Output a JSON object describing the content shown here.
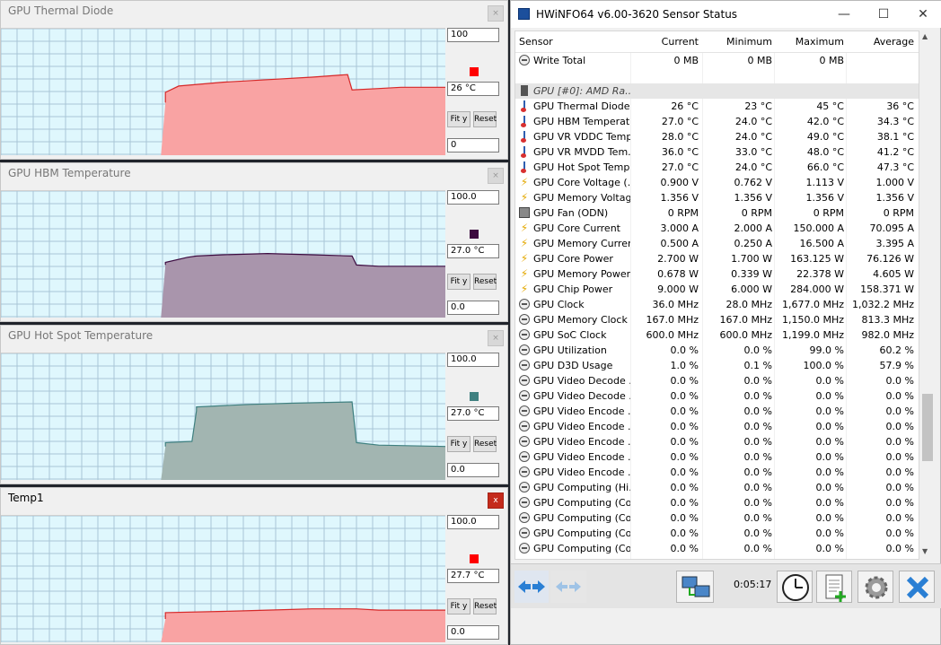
{
  "graphs": [
    {
      "title": "GPU Thermal Diode",
      "top": "100",
      "current": "26 °C",
      "bottom": "0",
      "color": "#ff0000",
      "fill": "#f9a3a3",
      "stroke": "#d62828",
      "active": false,
      "close": "×",
      "trace": [
        [
          0,
          40
        ],
        [
          10,
          40
        ],
        [
          10,
          42
        ],
        [
          37,
          42
        ],
        [
          37,
          50
        ],
        [
          40,
          55
        ],
        [
          50,
          58
        ],
        [
          60,
          60
        ],
        [
          70,
          62
        ],
        [
          78,
          64
        ],
        [
          79,
          52
        ],
        [
          85,
          53
        ],
        [
          90,
          54
        ],
        [
          95,
          54
        ],
        [
          100,
          54
        ]
      ],
      "ymax": 100
    },
    {
      "title": "GPU HBM Temperature",
      "top": "100.0",
      "current": "27.0 °C",
      "bottom": "0.0",
      "color": "#3d0b40",
      "fill": "#a995ac",
      "stroke": "#3d0b40",
      "active": false,
      "close": "×",
      "trace": [
        [
          0,
          40
        ],
        [
          10,
          40
        ],
        [
          10,
          42
        ],
        [
          37,
          42
        ],
        [
          37,
          44
        ],
        [
          42,
          48
        ],
        [
          44,
          49
        ],
        [
          50,
          50
        ],
        [
          60,
          51
        ],
        [
          70,
          50
        ],
        [
          79,
          49
        ],
        [
          80,
          42
        ],
        [
          85,
          41
        ],
        [
          100,
          41
        ]
      ],
      "ymax": 100
    },
    {
      "title": "GPU Hot Spot Temperature",
      "top": "100.0",
      "current": "27.0 °C",
      "bottom": "0.0",
      "color": "#3f8080",
      "fill": "#a2b5b1",
      "stroke": "#3f8080",
      "active": false,
      "close": "×",
      "trace": [
        [
          0,
          25
        ],
        [
          10,
          25
        ],
        [
          10,
          27
        ],
        [
          37,
          27
        ],
        [
          37,
          30
        ],
        [
          43,
          31
        ],
        [
          44,
          55
        ],
        [
          44,
          58
        ],
        [
          56,
          60
        ],
        [
          66,
          61
        ],
        [
          79,
          62
        ],
        [
          80,
          30
        ],
        [
          85,
          28
        ],
        [
          100,
          27
        ]
      ],
      "ymax": 100
    },
    {
      "title": "Temp1",
      "top": "100.0",
      "current": "27.7 °C",
      "bottom": "0.0",
      "color": "#ff0000",
      "fill": "#f9a3a3",
      "stroke": "#d62828",
      "active": true,
      "close": "x",
      "trace": [
        [
          0,
          18
        ],
        [
          10,
          18
        ],
        [
          10,
          19
        ],
        [
          37,
          19
        ],
        [
          37,
          24
        ],
        [
          50,
          25
        ],
        [
          60,
          26
        ],
        [
          70,
          27
        ],
        [
          80,
          27
        ],
        [
          85,
          26
        ],
        [
          100,
          26
        ]
      ],
      "ymax": 100
    }
  ],
  "fit_label": "Fit y",
  "reset_label": "Reset",
  "hwinfo": {
    "title": "HWiNFO64 v6.00-3620 Sensor Status",
    "columns": [
      "Sensor",
      "Current",
      "Minimum",
      "Maximum",
      "Average"
    ],
    "rows": [
      {
        "icon": "clock",
        "name": "Write Total",
        "cur": "0 MB",
        "min": "0 MB",
        "max": "0 MB",
        "avg": ""
      },
      {
        "icon": "none",
        "name": "",
        "cur": "",
        "min": "",
        "max": "",
        "avg": ""
      },
      {
        "icon": "gpu",
        "name": "GPU [#0]: AMD Ra...",
        "cur": "",
        "min": "",
        "max": "",
        "avg": "",
        "group": true
      },
      {
        "icon": "temp",
        "name": "GPU Thermal Diode",
        "cur": "26 °C",
        "min": "23 °C",
        "max": "45 °C",
        "avg": "36 °C"
      },
      {
        "icon": "temp",
        "name": "GPU HBM Temperat...",
        "cur": "27.0 °C",
        "min": "24.0 °C",
        "max": "42.0 °C",
        "avg": "34.3 °C"
      },
      {
        "icon": "temp",
        "name": "GPU VR VDDC Temp...",
        "cur": "28.0 °C",
        "min": "24.0 °C",
        "max": "49.0 °C",
        "avg": "38.1 °C"
      },
      {
        "icon": "temp",
        "name": "GPU VR MVDD Tem...",
        "cur": "36.0 °C",
        "min": "33.0 °C",
        "max": "48.0 °C",
        "avg": "41.2 °C"
      },
      {
        "icon": "temp",
        "name": "GPU Hot Spot Temp...",
        "cur": "27.0 °C",
        "min": "24.0 °C",
        "max": "66.0 °C",
        "avg": "47.3 °C"
      },
      {
        "icon": "volt",
        "name": "GPU Core Voltage (...",
        "cur": "0.900 V",
        "min": "0.762 V",
        "max": "1.113 V",
        "avg": "1.000 V"
      },
      {
        "icon": "volt",
        "name": "GPU Memory Voltag...",
        "cur": "1.356 V",
        "min": "1.356 V",
        "max": "1.356 V",
        "avg": "1.356 V"
      },
      {
        "icon": "fan",
        "name": "GPU Fan (ODN)",
        "cur": "0 RPM",
        "min": "0 RPM",
        "max": "0 RPM",
        "avg": "0 RPM"
      },
      {
        "icon": "volt",
        "name": "GPU Core Current",
        "cur": "3.000 A",
        "min": "2.000 A",
        "max": "150.000 A",
        "avg": "70.095 A"
      },
      {
        "icon": "volt",
        "name": "GPU Memory Current",
        "cur": "0.500 A",
        "min": "0.250 A",
        "max": "16.500 A",
        "avg": "3.395 A"
      },
      {
        "icon": "volt",
        "name": "GPU Core Power",
        "cur": "2.700 W",
        "min": "1.700 W",
        "max": "163.125 W",
        "avg": "76.126 W"
      },
      {
        "icon": "volt",
        "name": "GPU Memory Power",
        "cur": "0.678 W",
        "min": "0.339 W",
        "max": "22.378 W",
        "avg": "4.605 W"
      },
      {
        "icon": "volt",
        "name": "GPU Chip Power",
        "cur": "9.000 W",
        "min": "6.000 W",
        "max": "284.000 W",
        "avg": "158.371 W"
      },
      {
        "icon": "clock",
        "name": "GPU Clock",
        "cur": "36.0 MHz",
        "min": "28.0 MHz",
        "max": "1,677.0 MHz",
        "avg": "1,032.2 MHz"
      },
      {
        "icon": "clock",
        "name": "GPU Memory Clock",
        "cur": "167.0 MHz",
        "min": "167.0 MHz",
        "max": "1,150.0 MHz",
        "avg": "813.3 MHz"
      },
      {
        "icon": "clock",
        "name": "GPU SoC Clock",
        "cur": "600.0 MHz",
        "min": "600.0 MHz",
        "max": "1,199.0 MHz",
        "avg": "982.0 MHz"
      },
      {
        "icon": "clock",
        "name": "GPU Utilization",
        "cur": "0.0 %",
        "min": "0.0 %",
        "max": "99.0 %",
        "avg": "60.2 %"
      },
      {
        "icon": "clock",
        "name": "GPU D3D Usage",
        "cur": "1.0 %",
        "min": "0.1 %",
        "max": "100.0 %",
        "avg": "57.9 %"
      },
      {
        "icon": "clock",
        "name": "GPU Video Decode ...",
        "cur": "0.0 %",
        "min": "0.0 %",
        "max": "0.0 %",
        "avg": "0.0 %"
      },
      {
        "icon": "clock",
        "name": "GPU Video Decode ...",
        "cur": "0.0 %",
        "min": "0.0 %",
        "max": "0.0 %",
        "avg": "0.0 %"
      },
      {
        "icon": "clock",
        "name": "GPU Video Encode ...",
        "cur": "0.0 %",
        "min": "0.0 %",
        "max": "0.0 %",
        "avg": "0.0 %"
      },
      {
        "icon": "clock",
        "name": "GPU Video Encode ...",
        "cur": "0.0 %",
        "min": "0.0 %",
        "max": "0.0 %",
        "avg": "0.0 %"
      },
      {
        "icon": "clock",
        "name": "GPU Video Encode ...",
        "cur": "0.0 %",
        "min": "0.0 %",
        "max": "0.0 %",
        "avg": "0.0 %"
      },
      {
        "icon": "clock",
        "name": "GPU Video Encode ...",
        "cur": "0.0 %",
        "min": "0.0 %",
        "max": "0.0 %",
        "avg": "0.0 %"
      },
      {
        "icon": "clock",
        "name": "GPU Video Encode ...",
        "cur": "0.0 %",
        "min": "0.0 %",
        "max": "0.0 %",
        "avg": "0.0 %"
      },
      {
        "icon": "clock",
        "name": "GPU Computing (Hi...",
        "cur": "0.0 %",
        "min": "0.0 %",
        "max": "0.0 %",
        "avg": "0.0 %"
      },
      {
        "icon": "clock",
        "name": "GPU Computing (Co...",
        "cur": "0.0 %",
        "min": "0.0 %",
        "max": "0.0 %",
        "avg": "0.0 %"
      },
      {
        "icon": "clock",
        "name": "GPU Computing (Co...",
        "cur": "0.0 %",
        "min": "0.0 %",
        "max": "0.0 %",
        "avg": "0.0 %"
      },
      {
        "icon": "clock",
        "name": "GPU Computing (Co...",
        "cur": "0.0 %",
        "min": "0.0 %",
        "max": "0.0 %",
        "avg": "0.0 %"
      },
      {
        "icon": "clock",
        "name": "GPU Computing (Co...",
        "cur": "0.0 %",
        "min": "0.0 %",
        "max": "0.0 %",
        "avg": "0.0 %"
      }
    ],
    "timer": "0:05:17",
    "scroll_up": "▲",
    "scroll_down": "▼",
    "buttons": [
      "arrows-left-right-icon",
      "arrows-disabled-icon",
      "network-icon",
      "clock-icon",
      "report-icon",
      "settings-icon",
      "close-x-icon"
    ]
  }
}
